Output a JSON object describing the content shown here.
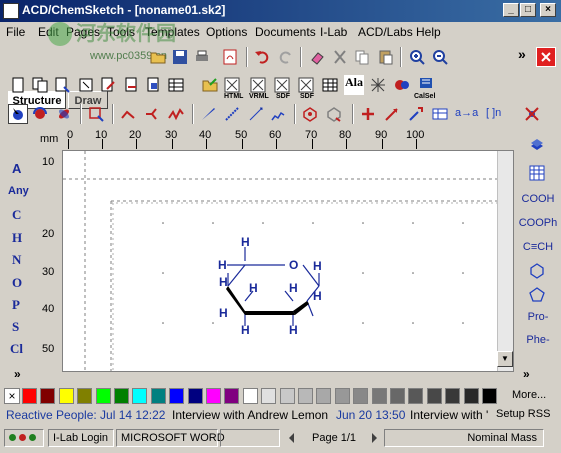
{
  "window": {
    "title": "ACD/ChemSketch - [noname01.sk2]"
  },
  "menu": [
    "File",
    "Edit",
    "Pages",
    "Tools",
    "Templates",
    "Options",
    "Documents",
    "I-Lab",
    "ACD/Labs",
    "Help"
  ],
  "mode_tabs": {
    "structure": "Structure",
    "draw": "Draw"
  },
  "overlay_text": {
    "watermark": "www.pc0359.cn",
    "chevron": "»"
  },
  "toolbar2": {
    "vrml": "VRML",
    "html": "HTML",
    "sdf": "SDF",
    "sdf2": "SDF",
    "ala": "Ala",
    "calsel": "CalSel"
  },
  "toolbar3": {
    "arrow_label": "a→a",
    "bracket_label": "[ ]n"
  },
  "ruler": {
    "unit": "mm",
    "top_ticks": [
      "0",
      "10",
      "20",
      "30",
      "40",
      "50",
      "60",
      "70",
      "80",
      "90",
      "100"
    ],
    "left_ticks": [
      "10",
      "20",
      "30",
      "40",
      "50"
    ]
  },
  "left_panel": {
    "elements": [
      "A",
      "Any",
      "C",
      "H",
      "N",
      "O",
      "P",
      "S",
      "Cl"
    ],
    "more": "»"
  },
  "right_panel": {
    "items": [
      "COOH",
      "COOPh",
      "C≡CH",
      "Pro-",
      "Phe-"
    ],
    "more": "»"
  },
  "molecule": {
    "ring_oxygen": "O",
    "hydrogens": [
      "H",
      "H",
      "H",
      "H",
      "H",
      "H",
      "H",
      "H",
      "H",
      "H"
    ]
  },
  "palette": {
    "colors": [
      "#ff0000",
      "#800000",
      "#ffff00",
      "#808000",
      "#00ff00",
      "#008000",
      "#00ffff",
      "#008080",
      "#0000ff",
      "#000080",
      "#ff00ff",
      "#800080",
      "#ffffff",
      "#e0e0e0",
      "#c8c8c8",
      "#b8b8b8",
      "#a8a8a8",
      "#989898",
      "#888888",
      "#787878",
      "#686868",
      "#585858",
      "#484848",
      "#383838",
      "#282828",
      "#000000"
    ],
    "more_label": "More..."
  },
  "news": {
    "item1_head": "Reactive People: Jul 14 12:22",
    "item1_body": "Interview with Andrew Lemon",
    "item2_head": "Jun 20 13:50",
    "item2_body": "Interview with '",
    "setup": "Setup RSS"
  },
  "status": {
    "ilab": "I-Lab Login",
    "app": "MICROSOFT WORD",
    "page": "Page 1/1",
    "mass": "Nominal Mass"
  }
}
